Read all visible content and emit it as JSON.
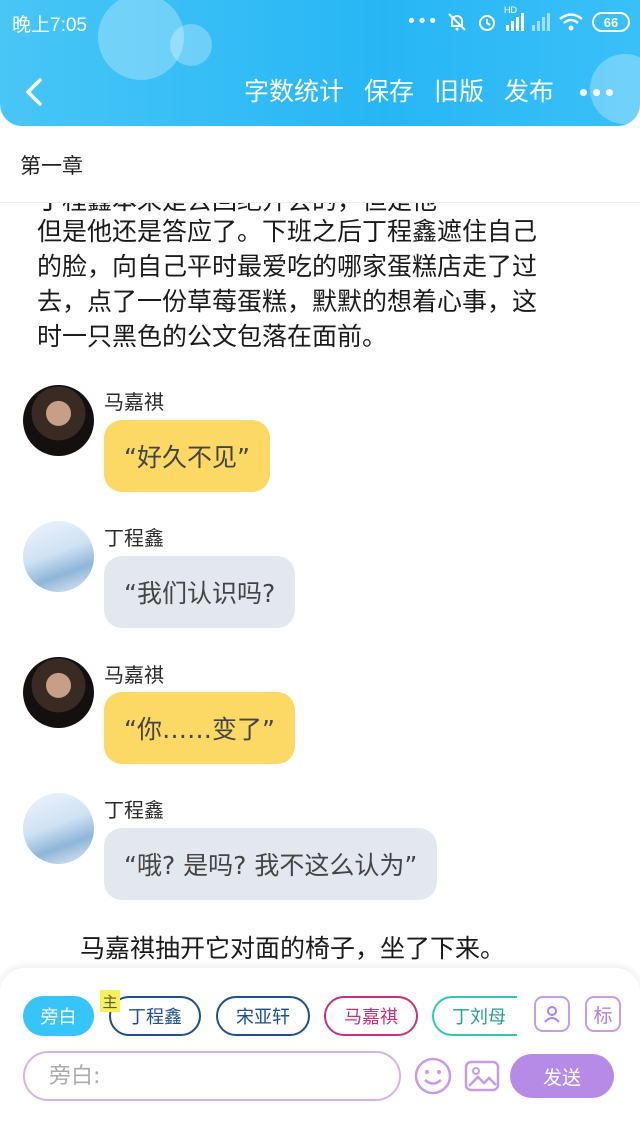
{
  "status_bar": {
    "time": "晚上7:05",
    "network_badge": "HD",
    "battery": "66"
  },
  "toolbar": {
    "word_count": "字数统计",
    "save": "保存",
    "old_version": "旧版",
    "publish": "发布"
  },
  "chapter_title": "第一章",
  "story": {
    "para_top_partial": "丁程鑫本来是去回绝开会的，但是他",
    "para_lines": [
      "但是他还是答应了。下班之后丁程鑫遮住自己",
      "的脸，向自己平时最爱吃的哪家蛋糕店走了过",
      "去，点了一份草莓蛋糕，默默的想着心事，这",
      "时一只黑色的公文包落在面前。"
    ],
    "para_bottom": "马嘉祺抽开它对面的椅子，坐了下来。"
  },
  "messages": [
    {
      "speaker": "马嘉祺",
      "text": "“好久不见”",
      "style": "yellow"
    },
    {
      "speaker": "丁程鑫",
      "text": "“我们认识吗?",
      "style": "grey"
    },
    {
      "speaker": "马嘉祺",
      "text": "“你……变了”",
      "style": "yellow"
    },
    {
      "speaker": "丁程鑫",
      "text": "“哦? 是吗? 我不这么认为”",
      "style": "grey"
    }
  ],
  "roles": {
    "narration": "旁白",
    "main_tag": "主",
    "items": [
      "丁程鑫",
      "宋亚轩",
      "马嘉祺",
      "丁刘母"
    ],
    "label_icon_text": "标"
  },
  "input": {
    "placeholder": "旁白:",
    "send": "发送"
  },
  "colors": {
    "header": "#27b6f5",
    "yellow_bubble": "#fcd964",
    "grey_bubble": "#e3e7ee",
    "send": "#b68be7",
    "narration_chip": "#37c4f8"
  }
}
